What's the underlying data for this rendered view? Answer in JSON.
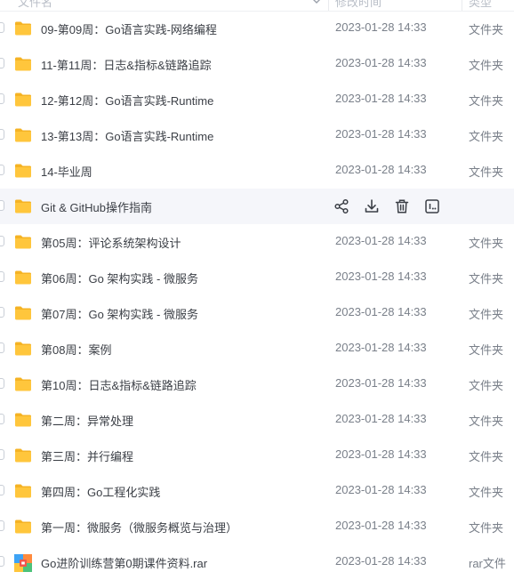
{
  "header": {
    "name_col": "文件名",
    "date_col": "修改时间",
    "type_col": "类型"
  },
  "colors": {
    "folder": "#ffc63c",
    "folder_back": "#f5b324",
    "hover_row": "#f5f6fa",
    "text": "#3b3f46",
    "muted": "#7a808a"
  },
  "rows": [
    {
      "name": "09-第09周：Go语言实践-网络编程",
      "date": "2023-01-28 14:33",
      "type": "文件夹",
      "icon": "folder-icon"
    },
    {
      "name": "11-第11周：日志&指标&链路追踪",
      "date": "2023-01-28 14:33",
      "type": "文件夹",
      "icon": "folder-icon"
    },
    {
      "name": "12-第12周：Go语言实践-Runtime",
      "date": "2023-01-28 14:33",
      "type": "文件夹",
      "icon": "folder-icon"
    },
    {
      "name": "13-第13周：Go语言实践-Runtime",
      "date": "2023-01-28 14:33",
      "type": "文件夹",
      "icon": "folder-icon"
    },
    {
      "name": "14-毕业周",
      "date": "2023-01-28 14:33",
      "type": "文件夹",
      "icon": "folder-icon"
    },
    {
      "name": "Git & GitHub操作指南",
      "date": "",
      "type": "",
      "icon": "folder-icon",
      "hover": true,
      "actions": [
        "share-icon",
        "download-icon",
        "delete-icon",
        "more-icon"
      ]
    },
    {
      "name": "第05周：评论系统架构设计",
      "date": "2023-01-28 14:33",
      "type": "文件夹",
      "icon": "folder-icon"
    },
    {
      "name": "第06周：Go 架构实践 - 微服务",
      "date": "2023-01-28 14:33",
      "type": "文件夹",
      "icon": "folder-icon"
    },
    {
      "name": "第07周：Go 架构实践 - 微服务",
      "date": "2023-01-28 14:33",
      "type": "文件夹",
      "icon": "folder-icon"
    },
    {
      "name": "第08周：案例",
      "date": "2023-01-28 14:33",
      "type": "文件夹",
      "icon": "folder-icon"
    },
    {
      "name": "第10周：日志&指标&链路追踪",
      "date": "2023-01-28 14:33",
      "type": "文件夹",
      "icon": "folder-icon"
    },
    {
      "name": "第二周：异常处理",
      "date": "2023-01-28 14:33",
      "type": "文件夹",
      "icon": "folder-icon"
    },
    {
      "name": "第三周：并行编程",
      "date": "2023-01-28 14:33",
      "type": "文件夹",
      "icon": "folder-icon"
    },
    {
      "name": "第四周：Go工程化实践",
      "date": "2023-01-28 14:33",
      "type": "文件夹",
      "icon": "folder-icon"
    },
    {
      "name": "第一周：微服务（微服务概览与治理）",
      "date": "2023-01-28 14:33",
      "type": "文件夹",
      "icon": "folder-icon"
    },
    {
      "name": "Go进阶训练营第0期课件资料.rar",
      "date": "2023-01-28 14:33",
      "type": "rar文件",
      "icon": "rar-file-icon"
    }
  ]
}
